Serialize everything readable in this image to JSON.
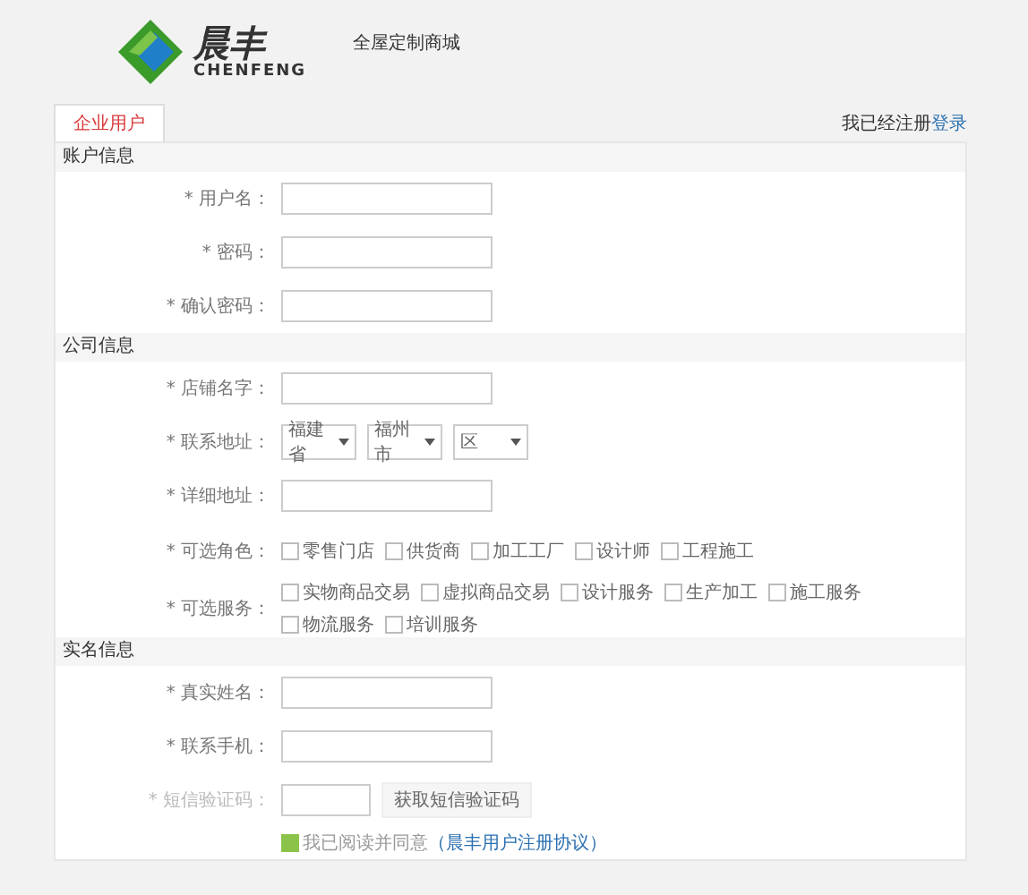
{
  "header": {
    "brand": "晨丰",
    "brand_latin": "CHENFENG",
    "tagline": "全屋定制商城"
  },
  "tabs": [
    {
      "label": "企业用户",
      "selected": true
    }
  ],
  "login_prompt": {
    "text": "我已经注册",
    "link": "登录"
  },
  "sections": [
    {
      "title": "账户信息",
      "fields": [
        {
          "kind": "input",
          "label": "* 用户名："
        },
        {
          "kind": "input",
          "label": "* 密码："
        },
        {
          "kind": "input",
          "label": "* 确认密码："
        }
      ]
    },
    {
      "title": "公司信息",
      "fields": [
        {
          "kind": "input",
          "label": "* 店铺名字："
        },
        {
          "kind": "selects",
          "label": "* 联系地址：",
          "options": [
            "福建省",
            "福州市",
            "区"
          ]
        },
        {
          "kind": "input",
          "label": "* 详细地址："
        },
        {
          "kind": "checkboxes",
          "label": "* 可选角色：",
          "items": [
            {
              "label": "零售门店",
              "checked": false
            },
            {
              "label": "供货商",
              "checked": false
            },
            {
              "label": "加工工厂",
              "checked": false
            },
            {
              "label": "设计师",
              "checked": false
            },
            {
              "label": "工程施工",
              "checked": false
            }
          ]
        },
        {
          "kind": "checkboxes",
          "label": "* 可选服务：",
          "items": [
            {
              "label": "实物商品交易",
              "checked": false
            },
            {
              "label": "虚拟商品交易",
              "checked": false
            },
            {
              "label": "设计服务",
              "checked": false
            },
            {
              "label": "生产加工",
              "checked": false
            },
            {
              "label": "施工服务",
              "checked": false
            },
            {
              "label": "物流服务",
              "checked": false
            },
            {
              "label": "培训服务",
              "checked": false
            }
          ]
        }
      ]
    },
    {
      "title": "实名信息",
      "fields": [
        {
          "kind": "input",
          "label": "* 真实姓名："
        },
        {
          "kind": "input",
          "label": "* 联系手机："
        },
        {
          "kind": "sms",
          "label": "* 短信验证码：",
          "button": "获取短信验证码"
        }
      ]
    }
  ],
  "agreement": {
    "text": "我已阅读并同意",
    "link": "（晨丰用户注册协议）",
    "checked": true
  }
}
